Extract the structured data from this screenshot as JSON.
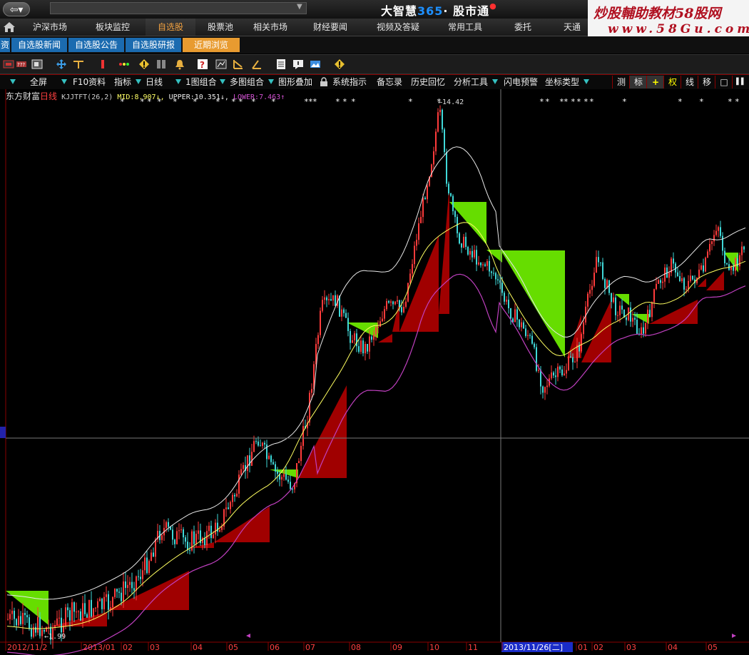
{
  "app": {
    "brand_main": "大智慧",
    "brand_num": "365",
    "brand_dot": "·",
    "brand_sub": "股市通"
  },
  "watermark": {
    "line1": "炒股輔助教材58股网",
    "line2": "www.58Gu.com"
  },
  "nav": {
    "items": [
      "沪深市场",
      "板块监控",
      "自选股",
      "股票池",
      "相关市场",
      "财经要闻",
      "视频及答疑",
      "常用工具",
      "委托",
      "天通"
    ],
    "active_index": 2
  },
  "subtabs": {
    "first": "资",
    "items": [
      "自选股新闻",
      "自选股公告",
      "自选股研报",
      "近期浏览"
    ],
    "active_index": 3
  },
  "menu": {
    "items": [
      "全屏",
      "F10资料",
      "指标",
      "日线",
      "1图组合",
      "多图组合",
      "图形叠加",
      "系统指示",
      "备忘录",
      "历史回忆",
      "分析工具",
      "闪电预警",
      "坐标类型"
    ],
    "right_buttons": [
      "测",
      "标",
      "+",
      "权",
      "线",
      "移",
      "□",
      "▌▌"
    ]
  },
  "indicator": {
    "stock": "东方财富",
    "period": "日线",
    "formula": "KJJTFT(26,2)",
    "mid_label": "MID:",
    "mid": "8.907",
    "upper_label": "UPPER:",
    "upper": "10.351",
    "lower_label": "LOWER:",
    "lower": "7.463"
  },
  "annotations": {
    "high": "14.42",
    "low": "1.99"
  },
  "xaxis": {
    "labels": [
      "2012/11/2",
      "2013/01",
      "02",
      "03",
      "04",
      "05",
      "06",
      "07",
      "08",
      "09",
      "10",
      "11",
      "2013/11/26[二]",
      "01",
      "02",
      "03",
      "04",
      "05"
    ],
    "cursor_date": "2013/11/26[二]"
  },
  "colors": {
    "up": "#ff3b3b",
    "down": "#40d8d8",
    "mid": "#ffff60",
    "upper": "#e8e8e8",
    "lower": "#c040c0",
    "box_up": "#a00000",
    "box_down": "#66dd00"
  },
  "icons": [
    "back-arrow-icon",
    "home-icon",
    "menu-toggle-icon",
    "grid-icon",
    "move-icon",
    "align-icon",
    "red-bar-icon",
    "traffic-light-icon",
    "warning-icon",
    "columns-icon",
    "bell-icon",
    "question-icon",
    "chart-box-icon",
    "line-tool-icon",
    "angle-tool-icon",
    "angle-tool-alt-icon",
    "list-icon",
    "message-icon",
    "photo-icon",
    "diamond-icon"
  ]
}
